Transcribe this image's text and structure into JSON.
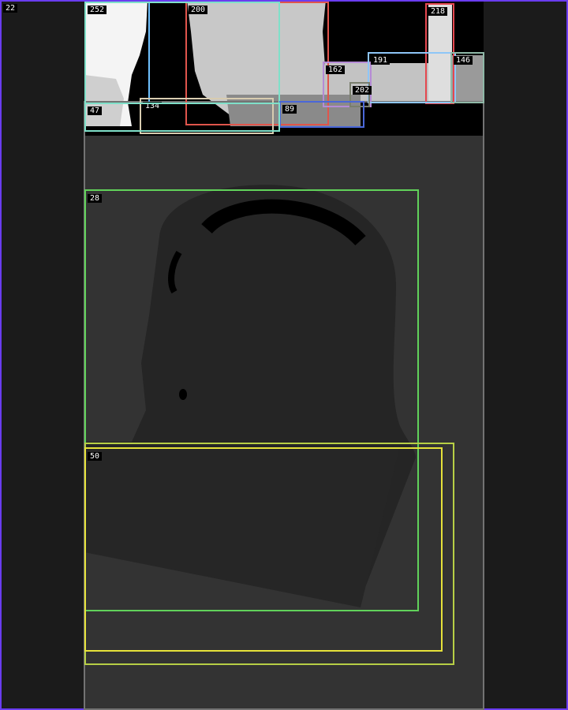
{
  "colors": {
    "screen_border": "#6a3cf0",
    "page_bg": "#333333",
    "side_bg": "#1b1b1b"
  },
  "boxes": [
    {
      "id": "box-22",
      "label": "22",
      "color": "#6a3cf0"
    },
    {
      "id": "box-252",
      "label": "252",
      "color": "#6fc1ff"
    },
    {
      "id": "box-200",
      "label": "200",
      "color": "#e0554c"
    },
    {
      "id": "box-218",
      "label": "218",
      "color": "#e5474f"
    },
    {
      "id": "box-162",
      "label": "162",
      "color": "#b58bd6"
    },
    {
      "id": "box-191",
      "label": "191",
      "color": "#8ec6f7"
    },
    {
      "id": "box-146",
      "label": "146",
      "color": "#8fb8a7"
    },
    {
      "id": "box-202",
      "label": "202",
      "color": "#7a7f6e"
    },
    {
      "id": "box-89",
      "label": "89",
      "color": "#4a67d8"
    },
    {
      "id": "box-134",
      "label": "134",
      "color": "#d8ccb0"
    },
    {
      "id": "box-47",
      "label": "47",
      "color": "#7fe0c9"
    },
    {
      "id": "box-28",
      "label": "28",
      "color": "#61d25a"
    },
    {
      "id": "box-50",
      "label": "50",
      "color": "#e6e23a"
    },
    {
      "id": "box-outer",
      "label": "",
      "color": "#b7cf45"
    },
    {
      "id": "box-main",
      "label": "",
      "color": "#737373"
    }
  ]
}
